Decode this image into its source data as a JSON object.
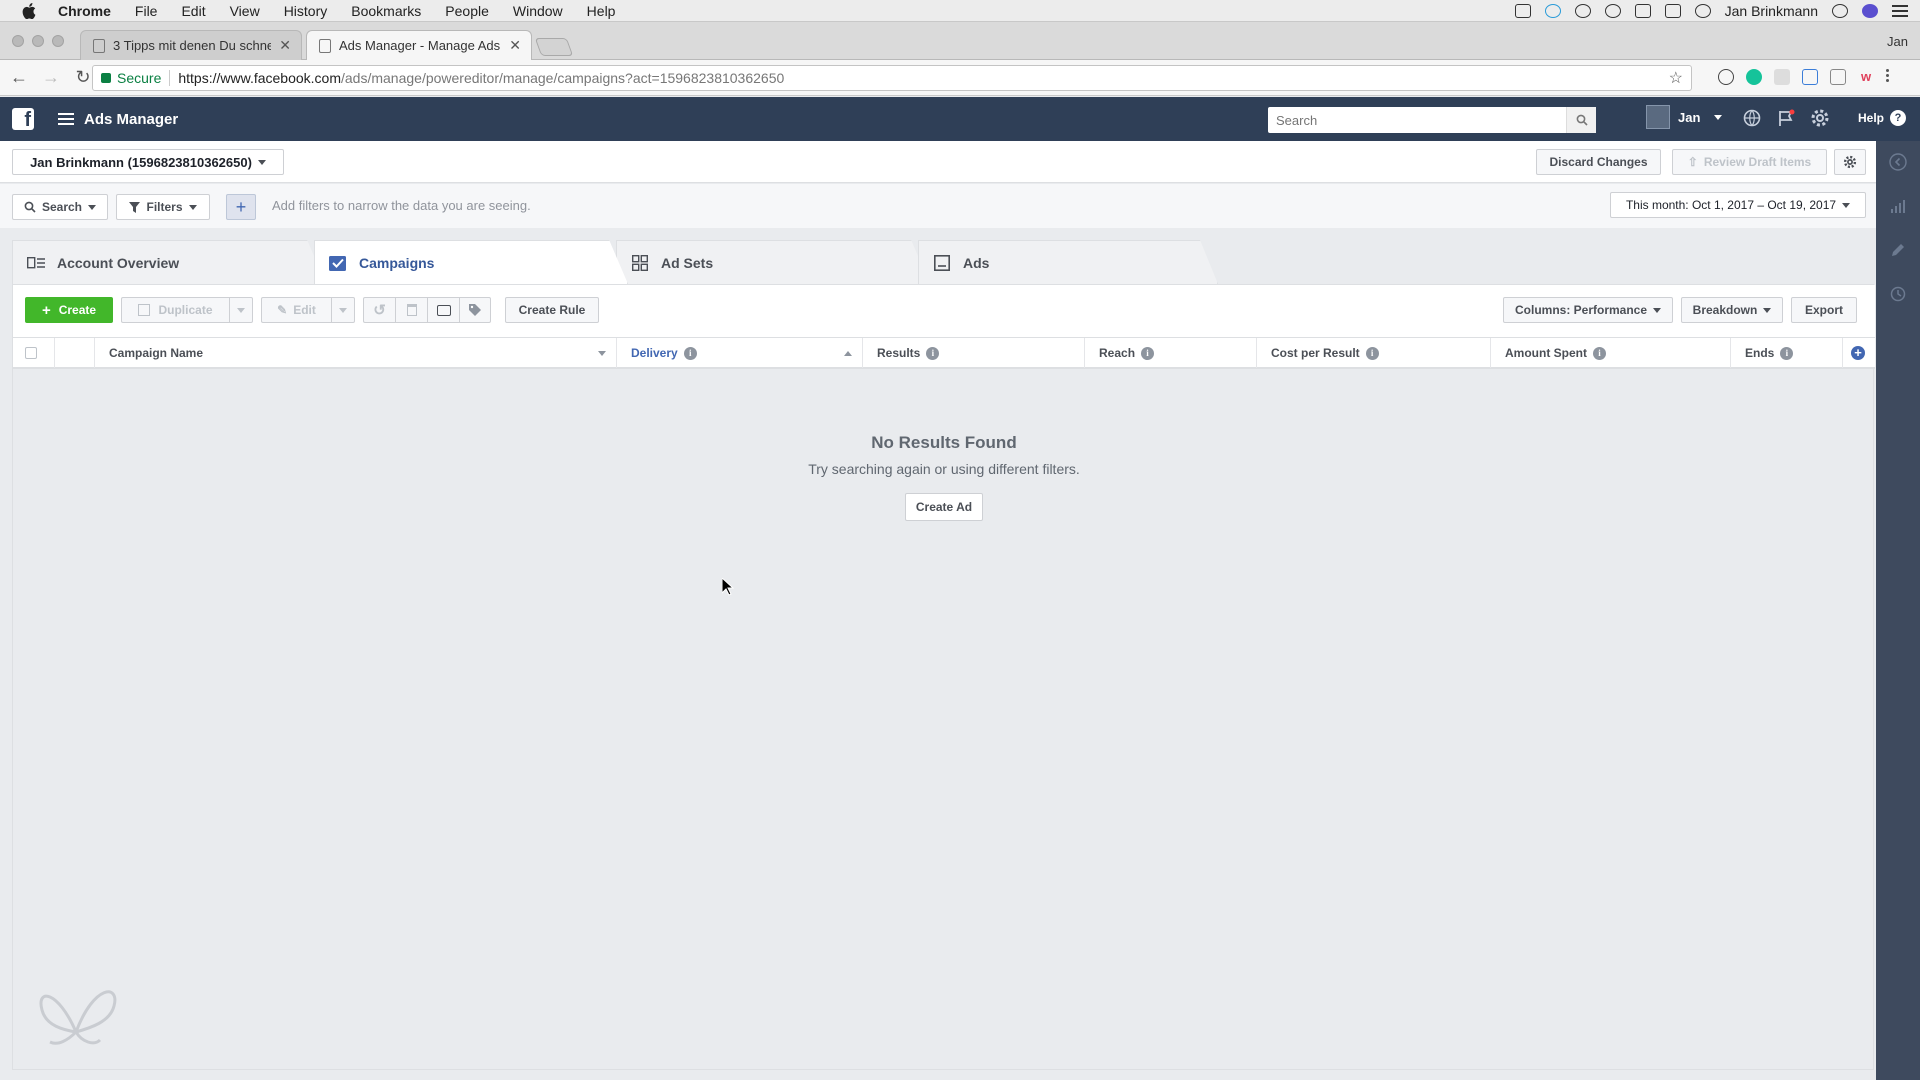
{
  "mac_menu": {
    "app": "Chrome",
    "items": [
      "File",
      "Edit",
      "View",
      "History",
      "Bookmarks",
      "People",
      "Window",
      "Help"
    ],
    "user": "Jan Brinkmann"
  },
  "browser": {
    "tabs": [
      {
        "title": "3 Tipps mit denen Du schnelle",
        "active": false
      },
      {
        "title": "Ads Manager - Manage Ads - ",
        "active": true
      }
    ],
    "profile": "Jan",
    "secure_label": "Secure",
    "url_host": "https://www.facebook.com",
    "url_path": "/ads/manage/powereditor/manage/campaigns?act=1596823810362650"
  },
  "fb_header": {
    "app_title": "Ads Manager",
    "search_placeholder": "Search",
    "user_name": "Jan",
    "help_label": "Help"
  },
  "account_bar": {
    "account": "Jan Brinkmann (1596823810362650)",
    "discard": "Discard Changes",
    "review": "Review Draft Items"
  },
  "filter_bar": {
    "search": "Search",
    "filters": "Filters",
    "hint": "Add filters to narrow the data you are seeing.",
    "date_range": "This month: Oct 1, 2017 – Oct 19, 2017"
  },
  "level_tabs": {
    "account_overview": "Account Overview",
    "campaigns": "Campaigns",
    "ad_sets": "Ad Sets",
    "ads": "Ads"
  },
  "actions": {
    "create": "Create",
    "duplicate": "Duplicate",
    "edit": "Edit",
    "create_rule": "Create Rule",
    "columns": "Columns: Performance",
    "breakdown": "Breakdown",
    "export": "Export"
  },
  "table": {
    "columns": [
      "Campaign Name",
      "Delivery",
      "Results",
      "Reach",
      "Cost per Result",
      "Amount Spent",
      "Ends"
    ],
    "sorted_column": "Delivery"
  },
  "empty_state": {
    "title": "No Results Found",
    "subtitle": "Try searching again or using different filters.",
    "button": "Create Ad"
  },
  "colors": {
    "fb_header": "#2f3f57",
    "create_green": "#42b72a",
    "link_blue": "#4267b2"
  }
}
